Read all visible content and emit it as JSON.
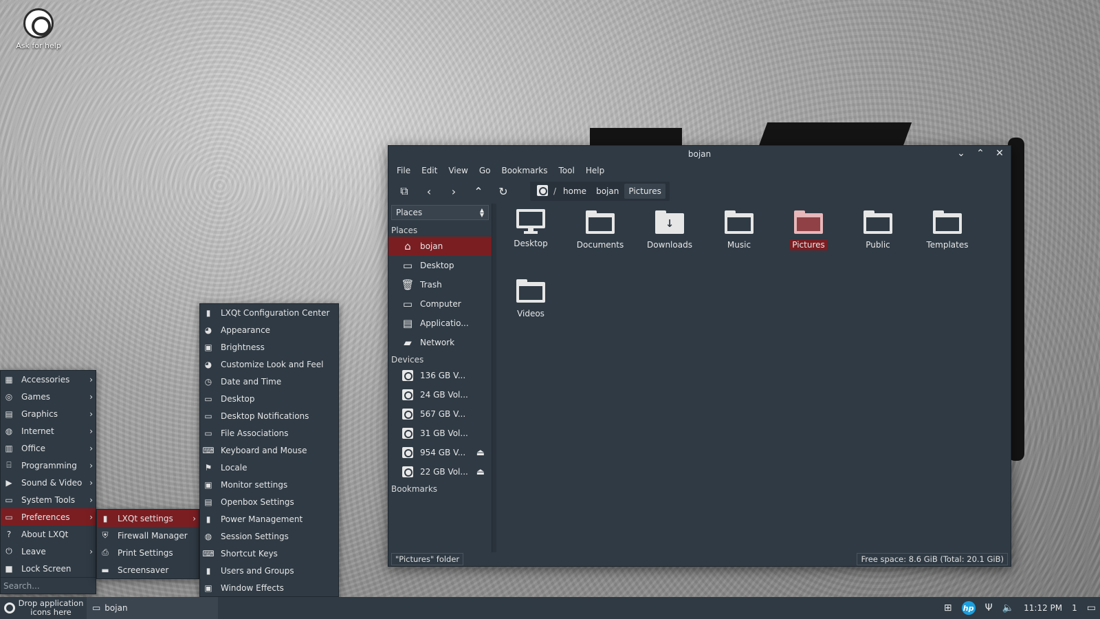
{
  "desktop": {
    "icons": [
      {
        "label": "Ask for help",
        "icon": "help-ring-icon"
      }
    ]
  },
  "window": {
    "title": "bojan",
    "menu": [
      "File",
      "Edit",
      "View",
      "Go",
      "Bookmarks",
      "Tool",
      "Help"
    ],
    "path": {
      "root": "/",
      "segments": [
        "home",
        "bojan",
        "Pictures"
      ],
      "current": "Pictures"
    },
    "sidebar": {
      "selector": "Places",
      "places_header": "Places",
      "places": [
        {
          "label": "bojan",
          "icon": "home-icon",
          "active": true
        },
        {
          "label": "Desktop",
          "icon": "monitor-icon"
        },
        {
          "label": "Trash",
          "icon": "trash-icon"
        },
        {
          "label": "Computer",
          "icon": "computer-icon"
        },
        {
          "label": "Applicatio...",
          "icon": "applications-icon"
        },
        {
          "label": "Network",
          "icon": "network-icon"
        }
      ],
      "devices_header": "Devices",
      "devices": [
        {
          "label": "136 GB V...",
          "eject": false
        },
        {
          "label": "24 GB Vol...",
          "eject": false
        },
        {
          "label": "567 GB V...",
          "eject": false
        },
        {
          "label": "31 GB Vol...",
          "eject": false
        },
        {
          "label": "954 GB V...",
          "eject": true
        },
        {
          "label": "22 GB Vol...",
          "eject": true
        }
      ],
      "bookmarks_header": "Bookmarks"
    },
    "files": [
      {
        "label": "Desktop",
        "kind": "monitor"
      },
      {
        "label": "Documents",
        "kind": "folder"
      },
      {
        "label": "Downloads",
        "kind": "download"
      },
      {
        "label": "Music",
        "kind": "folder"
      },
      {
        "label": "Pictures",
        "kind": "folder",
        "selected": true
      },
      {
        "label": "Public",
        "kind": "folder"
      },
      {
        "label": "Templates",
        "kind": "folder"
      },
      {
        "label": "Videos",
        "kind": "folder"
      }
    ],
    "status_left": "\"Pictures\" folder",
    "status_right": "Free space: 8.6 GiB (Total: 20.1 GiB)"
  },
  "main_menu": {
    "items": [
      {
        "label": "Accessories",
        "icon": "▦",
        "sub": true
      },
      {
        "label": "Games",
        "icon": "◎",
        "sub": true
      },
      {
        "label": "Graphics",
        "icon": "▤",
        "sub": true
      },
      {
        "label": "Internet",
        "icon": "◍",
        "sub": true
      },
      {
        "label": "Office",
        "icon": "▥",
        "sub": true
      },
      {
        "label": "Programming",
        "icon": "⌸",
        "sub": true
      },
      {
        "label": "Sound & Video",
        "icon": "▶",
        "sub": true
      },
      {
        "label": "System Tools",
        "icon": "▭",
        "sub": true
      },
      {
        "label": "Preferences",
        "icon": "▭",
        "sub": true,
        "active": true
      },
      {
        "label": "About LXQt",
        "icon": "?",
        "sub": false
      },
      {
        "label": "Leave",
        "icon": "⏻",
        "sub": true
      },
      {
        "label": "Lock Screen",
        "icon": "■",
        "sub": false
      }
    ],
    "search_placeholder": "Search..."
  },
  "pref_menu": {
    "items": [
      {
        "label": "LXQt settings",
        "icon": "▮",
        "sub": true,
        "active": true
      },
      {
        "label": "Firewall Manager",
        "icon": "⛨",
        "sub": false
      },
      {
        "label": "Print Settings",
        "icon": "⎙",
        "sub": false
      },
      {
        "label": "Screensaver",
        "icon": "▬",
        "sub": false
      }
    ]
  },
  "lxqt_menu": {
    "items": [
      {
        "label": "LXQt Configuration Center",
        "icon": "▮"
      },
      {
        "label": "Appearance",
        "icon": "◕"
      },
      {
        "label": "Brightness",
        "icon": "▣"
      },
      {
        "label": "Customize Look and Feel",
        "icon": "◕"
      },
      {
        "label": "Date and Time",
        "icon": "◷"
      },
      {
        "label": "Desktop",
        "icon": "▭"
      },
      {
        "label": "Desktop Notifications",
        "icon": "▭"
      },
      {
        "label": "File Associations",
        "icon": "▭"
      },
      {
        "label": "Keyboard and Mouse",
        "icon": "⌨"
      },
      {
        "label": "Locale",
        "icon": "⚑"
      },
      {
        "label": "Monitor settings",
        "icon": "▣"
      },
      {
        "label": "Openbox Settings",
        "icon": "▤"
      },
      {
        "label": "Power Management",
        "icon": "▮"
      },
      {
        "label": "Session Settings",
        "icon": "◍"
      },
      {
        "label": "Shortcut Keys",
        "icon": "⌨"
      },
      {
        "label": "Users and Groups",
        "icon": "▮"
      },
      {
        "label": "Window Effects",
        "icon": "▣"
      }
    ]
  },
  "taskbar": {
    "drop_text": "Drop application icons here",
    "task": "bojan",
    "clock": "11:12 PM",
    "desktop_num": "1",
    "hp_label": "hp"
  }
}
